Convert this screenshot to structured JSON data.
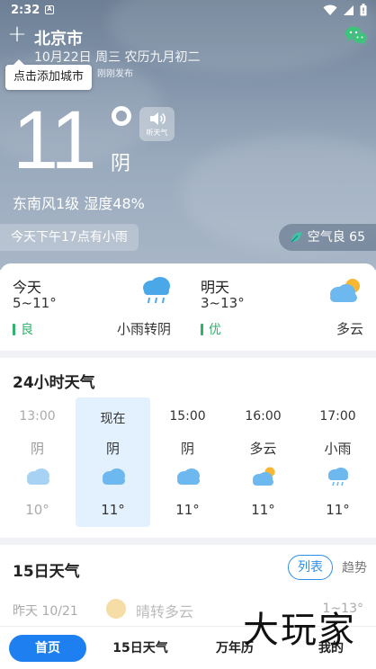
{
  "status_bar": {
    "time": "2:32",
    "notification_letter": "A"
  },
  "header": {
    "city": "北京市",
    "date_line": "10月22日 周三 农历九月初二",
    "publish_text": "刚刚发布",
    "tooltip": "点击添加城市"
  },
  "current": {
    "temperature": "11",
    "condition": "阴",
    "listen_label": "听天气",
    "wind_humidity": "东南风1级 湿度48%",
    "rain_notice": "今天下午17点有小雨",
    "air_quality": "空气良 65"
  },
  "today": {
    "title": "今天",
    "range": "5~11°",
    "aq": "良",
    "desc": "小雨转阴"
  },
  "tomorrow": {
    "title": "明天",
    "range": "3~13°",
    "aq": "优",
    "desc": "多云"
  },
  "hourly": {
    "title": "24小时天气",
    "items": [
      {
        "time": "13:00",
        "cond": "阴",
        "temp": "10°",
        "icon": "overcast-icon",
        "past": true
      },
      {
        "time": "现在",
        "cond": "阴",
        "temp": "11°",
        "icon": "overcast-icon",
        "now": true
      },
      {
        "time": "15:00",
        "cond": "阴",
        "temp": "11°",
        "icon": "overcast-icon"
      },
      {
        "time": "16:00",
        "cond": "多云",
        "temp": "11°",
        "icon": "partly-cloudy-icon"
      },
      {
        "time": "17:00",
        "cond": "小雨",
        "temp": "11°",
        "icon": "light-rain-icon"
      }
    ]
  },
  "forecast15": {
    "title": "15日天气",
    "tab_list": "列表",
    "tab_trend": "趋势",
    "yesterday": {
      "day": "昨天 10/21",
      "cond": "晴转多云",
      "range": "1~13°"
    }
  },
  "nav": {
    "home": "首页",
    "forecast": "15日天气",
    "calendar": "万年历",
    "mine": "我的"
  },
  "watermark": "大玩家",
  "colors": {
    "accent": "#1e7ff0",
    "good_air": "#2db36b",
    "now_highlight": "#e3f0fd"
  }
}
